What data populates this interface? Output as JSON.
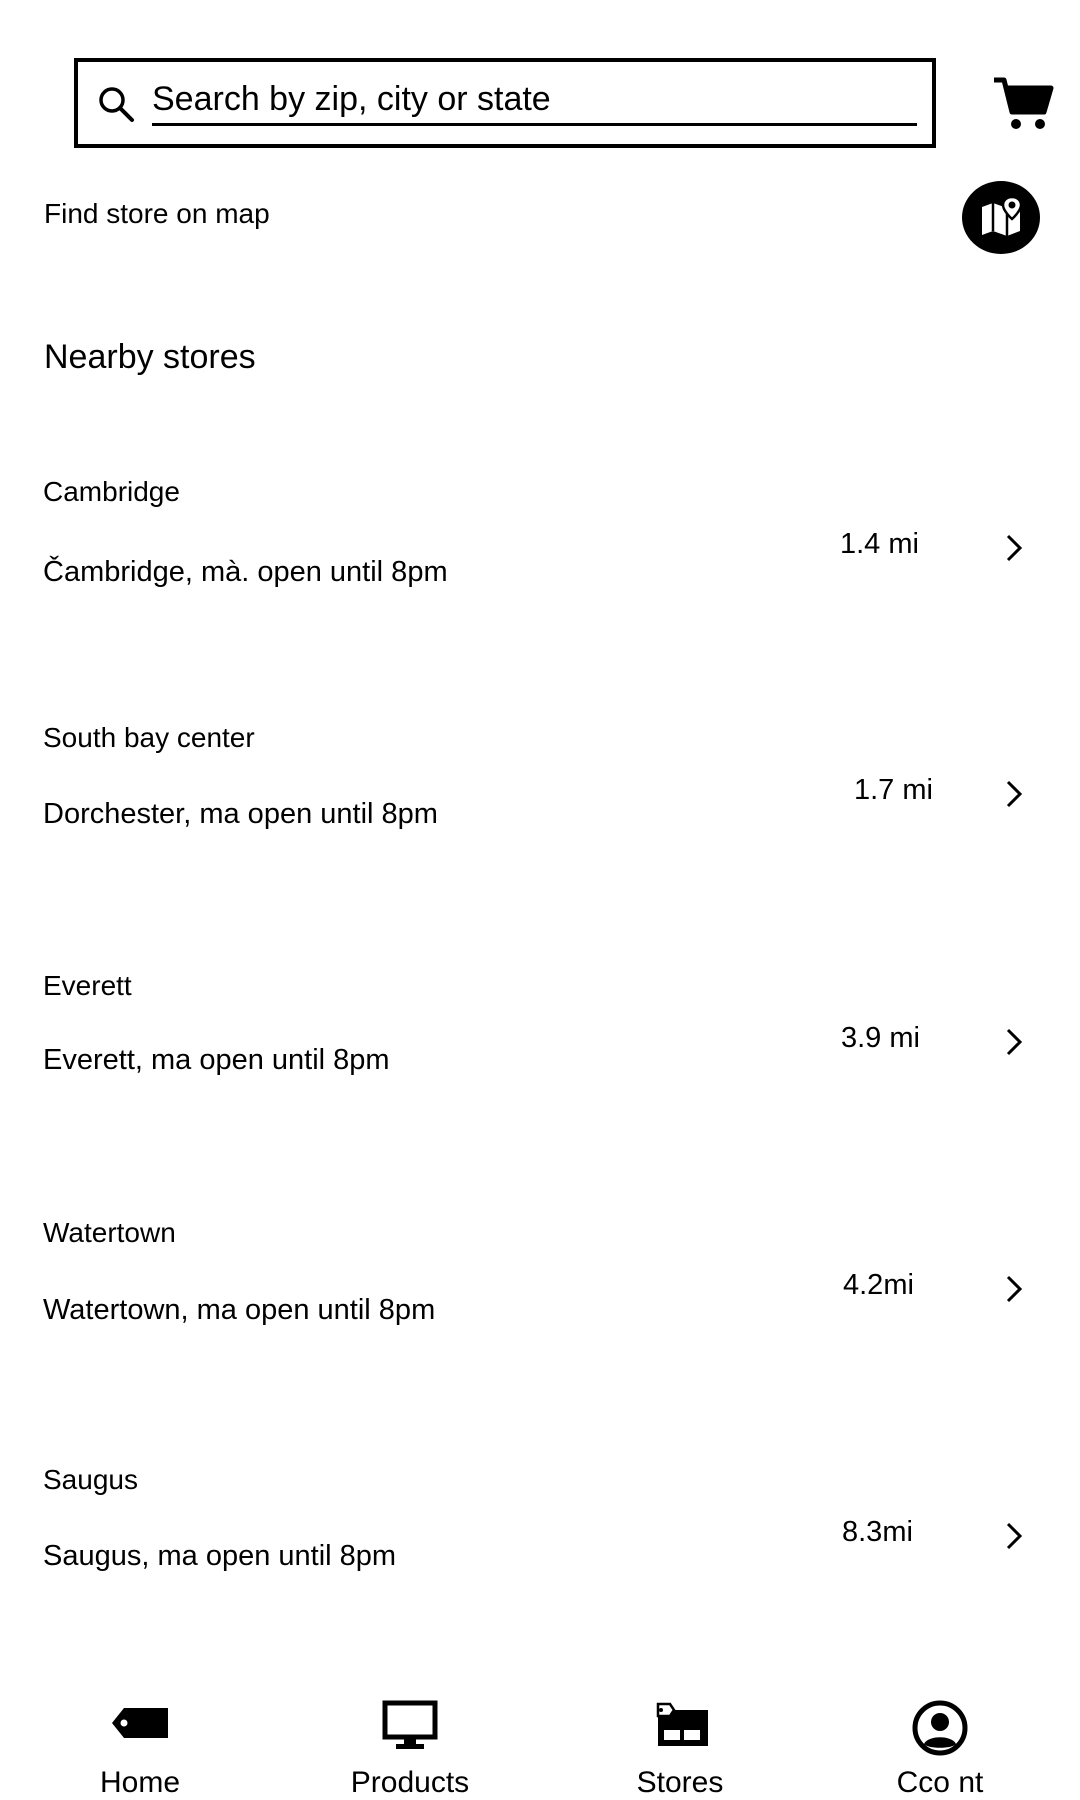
{
  "search": {
    "placeholder": "Search by zip, city or state"
  },
  "map_link": {
    "label": "Find store on map"
  },
  "nearby": {
    "title": "Nearby stores",
    "stores": [
      {
        "name": "Cambridge",
        "address": "Čambridge, mà. open until 8pm",
        "distance": "1.4 mi"
      },
      {
        "name": "South bay center",
        "address": "Dorchester, ma open until 8pm",
        "distance": "1.7 mi"
      },
      {
        "name": "Everett",
        "address": "Everett, ma open until 8pm",
        "distance": "3.9 mi"
      },
      {
        "name": "Watertown",
        "address": "Watertown, ma open until 8pm",
        "distance": "4.2mi"
      },
      {
        "name": "Saugus",
        "address": "Saugus, ma open until 8pm",
        "distance": "8.3mi"
      }
    ]
  },
  "nav": {
    "items": [
      {
        "label": "Home",
        "icon": "tag-icon"
      },
      {
        "label": "Products",
        "icon": "monitor-icon"
      },
      {
        "label": "Stores",
        "icon": "store-icon"
      },
      {
        "label": "Cco nt",
        "icon": "account-icon"
      }
    ]
  },
  "colors": {
    "text": "#000000",
    "background": "#ffffff"
  }
}
